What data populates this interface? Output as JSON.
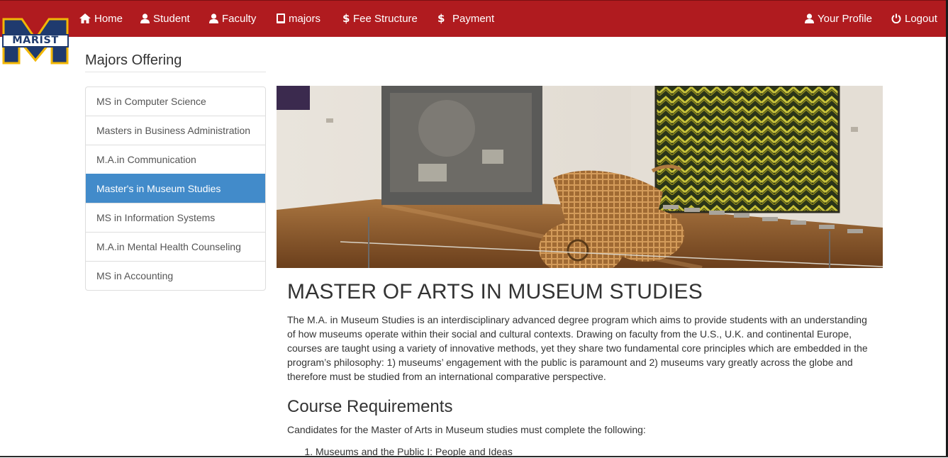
{
  "nav": {
    "left": [
      {
        "label": "Home",
        "icon": "home-icon"
      },
      {
        "label": "Student",
        "icon": "user-icon"
      },
      {
        "label": "Faculty",
        "icon": "user-icon"
      },
      {
        "label": "majors",
        "icon": "book-icon"
      },
      {
        "label": "Fee Structure",
        "icon": "dollar-icon"
      },
      {
        "label": "Payment",
        "icon": "dollar-icon"
      }
    ],
    "right": [
      {
        "label": "Your Profile",
        "icon": "user-icon"
      },
      {
        "label": "Logout",
        "icon": "power-icon"
      }
    ]
  },
  "logo": {
    "text": "MARIST"
  },
  "sidebar": {
    "title": "Majors Offering",
    "items": [
      {
        "label": "MS in Computer Science",
        "active": false
      },
      {
        "label": "Masters in Business Administration",
        "active": false
      },
      {
        "label": "M.A.in Communication",
        "active": false
      },
      {
        "label": "Master's in Museum Studies",
        "active": true
      },
      {
        "label": "MS in Information Systems",
        "active": false
      },
      {
        "label": "M.A.in Mental Health Counseling",
        "active": false
      },
      {
        "label": "MS in Accounting",
        "active": false
      }
    ]
  },
  "main": {
    "title": "MASTER OF ARTS IN MUSEUM STUDIES",
    "intro": "The M.A. in Museum Studies is an interdisciplinary advanced degree program which aims to provide students with an understanding of how museums operate within their social and cultural contexts. Drawing on faculty from the U.S., U.K. and continental Europe, courses are taught using a variety of innovative methods, yet they share two fundamental core principles which are embedded in the program’s philosophy: 1) museums’ engagement with the public is paramount and 2) museums vary greatly across the globe and therefore must be studied from an international comparative perspective.",
    "requirements_title": "Course Requirements",
    "requirements_lead": "Candidates for the Master of Arts in Museum studies must complete the following:",
    "requirements": [
      "Museums and the Public I: People and Ideas"
    ]
  },
  "colors": {
    "navbar": "#b01b1f",
    "active_item": "#428bca",
    "logo_navy": "#1f3a6e",
    "logo_gold": "#f2b705"
  }
}
